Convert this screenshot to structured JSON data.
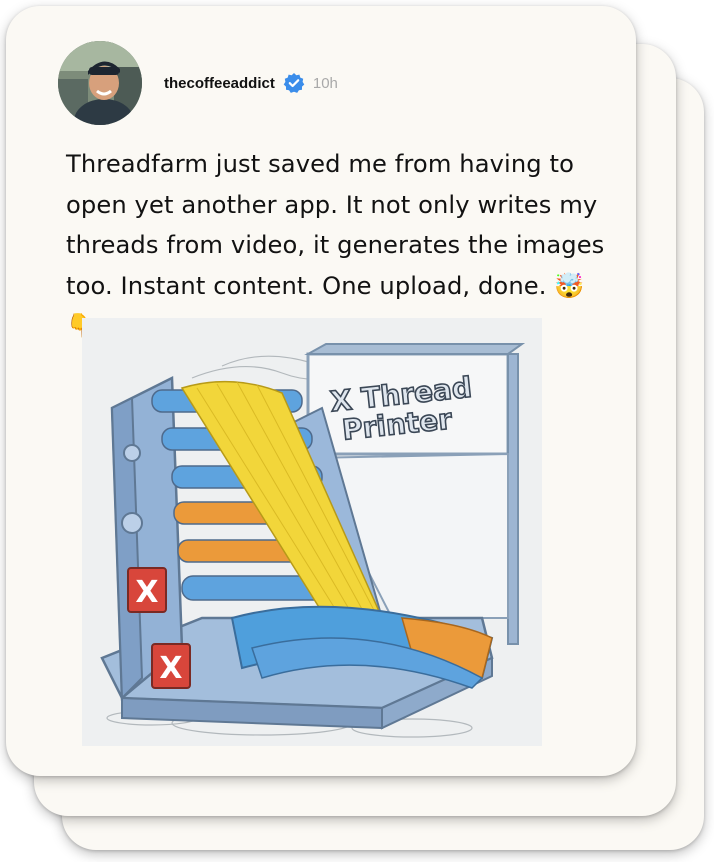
{
  "post": {
    "username": "thecoffeeaddict",
    "verified": true,
    "time": "10h",
    "text": "Threadfarm just saved me from having to open yet another app. It not only writes my threads from video, it generates the images too. Instant content. One upload, done. 🤯👇",
    "image": {
      "sign_line1": "X Thread",
      "sign_line2": "Printer",
      "badge_letter": "X"
    }
  },
  "colors": {
    "card_bg": "#fbf9f4",
    "verified_blue": "#3b8dea",
    "machine_blue": "#8fb2d8",
    "thread_yellow": "#f2d63a",
    "thread_blue": "#4f9fdc",
    "thread_orange": "#eb9a3a",
    "badge_red": "#d8463b"
  }
}
